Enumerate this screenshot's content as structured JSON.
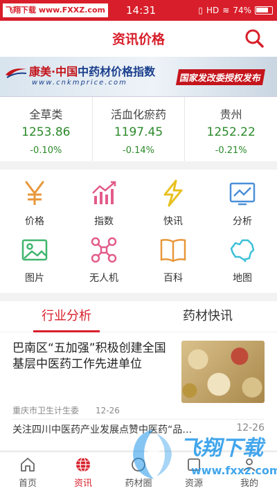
{
  "status_bar": {
    "watermark": "飞翔下载 www.FXXZ.com",
    "time": "14:31",
    "signal": "HD",
    "battery": "74%"
  },
  "header": {
    "title": "资讯价格",
    "search_icon": "search-icon"
  },
  "banner": {
    "brand_red": "康美·中国",
    "brand_blue": "中药材价格指数",
    "url": "www.cnkmprice.com",
    "slogan": "国家发改委授权发布"
  },
  "indices": [
    {
      "name": "全草类",
      "value": "1253.86",
      "change": "-0.10%"
    },
    {
      "name": "活血化瘀药",
      "value": "1197.45",
      "change": "-0.14%"
    },
    {
      "name": "贵州",
      "value": "1252.22",
      "change": "-0.21%"
    }
  ],
  "grid": [
    {
      "label": "价格",
      "icon": "yen-icon"
    },
    {
      "label": "指数",
      "icon": "chart-icon"
    },
    {
      "label": "快讯",
      "icon": "lightning-icon"
    },
    {
      "label": "分析",
      "icon": "line-chart-icon"
    },
    {
      "label": "图片",
      "icon": "image-icon"
    },
    {
      "label": "无人机",
      "icon": "drone-icon"
    },
    {
      "label": "百科",
      "icon": "book-icon"
    },
    {
      "label": "地图",
      "icon": "map-icon"
    }
  ],
  "tabs": [
    {
      "label": "行业分析",
      "active": true
    },
    {
      "label": "药材快讯",
      "active": false
    }
  ],
  "articles": [
    {
      "title": "巴南区“五加强”积极创建全国基层中医药工作先进单位",
      "source": "重庆市卫生计生委",
      "date": "12-26"
    },
    {
      "title": "关注四川中医药产业发展点赞中医药“品…",
      "date": "12-26"
    }
  ],
  "bottom_nav": [
    {
      "label": "首页",
      "icon": "home-icon",
      "active": false
    },
    {
      "label": "资讯",
      "icon": "globe-icon",
      "active": true
    },
    {
      "label": "药材圈",
      "icon": "circle-icon",
      "active": false
    },
    {
      "label": "资源",
      "icon": "resource-icon",
      "active": false
    },
    {
      "label": "我的",
      "icon": "user-icon",
      "active": false
    }
  ],
  "watermark": {
    "title": "飞翔下载",
    "url": "www.fxxz.com"
  },
  "colors": {
    "brand": "#d81e2a",
    "positive_green": "#2b8a2b",
    "icon_orange": "#e8973a",
    "icon_pink": "#e25b8a",
    "icon_yellow": "#e8c11f",
    "icon_blue": "#4a8fd9",
    "icon_green": "#3fb56e",
    "icon_cyan": "#3cc0d8"
  }
}
